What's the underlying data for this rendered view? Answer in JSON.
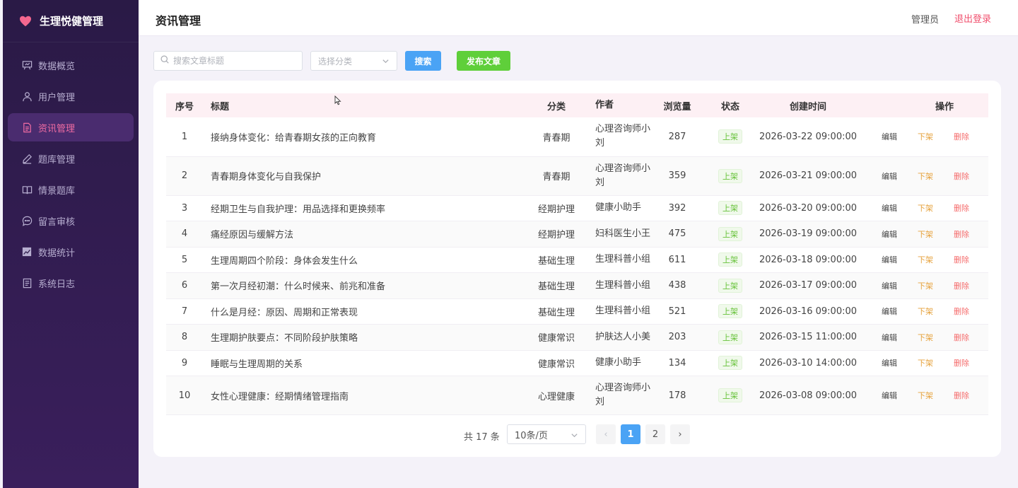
{
  "brand": {
    "title": "生理悦健管理"
  },
  "sidebar": {
    "items": [
      {
        "label": "数据概览",
        "icon": "presentation-icon",
        "active": false
      },
      {
        "label": "用户管理",
        "icon": "user-icon",
        "active": false
      },
      {
        "label": "资讯管理",
        "icon": "document-icon",
        "active": true
      },
      {
        "label": "题库管理",
        "icon": "pencil-icon",
        "active": false
      },
      {
        "label": "情景题库",
        "icon": "book-icon",
        "active": false
      },
      {
        "label": "留言审核",
        "icon": "chat-icon",
        "active": false
      },
      {
        "label": "数据统计",
        "icon": "chart-icon",
        "active": false
      },
      {
        "label": "系统日志",
        "icon": "log-icon",
        "active": false
      }
    ]
  },
  "header": {
    "title": "资讯管理",
    "admin": "管理员",
    "logout": "退出登录"
  },
  "toolbar": {
    "search_placeholder": "搜索文章标题",
    "category_placeholder": "选择分类",
    "search_label": "搜索",
    "publish_label": "发布文章"
  },
  "table": {
    "columns": [
      "序号",
      "标题",
      "分类",
      "作者",
      "浏览量",
      "状态",
      "创建时间",
      "操作"
    ],
    "rows": [
      {
        "idx": "1",
        "title": "接纳身体变化：给青春期女孩的正向教育",
        "category": "青春期",
        "author": "心理咨询师小刘",
        "views": "287",
        "status": "上架",
        "time": "2026-03-22 09:00:00"
      },
      {
        "idx": "2",
        "title": "青春期身体变化与自我保护",
        "category": "青春期",
        "author": "心理咨询师小刘",
        "views": "359",
        "status": "上架",
        "time": "2026-03-21 09:00:00"
      },
      {
        "idx": "3",
        "title": "经期卫生与自我护理：用品选择和更换频率",
        "category": "经期护理",
        "author": "健康小助手",
        "views": "392",
        "status": "上架",
        "time": "2026-03-20 09:00:00"
      },
      {
        "idx": "4",
        "title": "痛经原因与缓解方法",
        "category": "经期护理",
        "author": "妇科医生小王",
        "views": "475",
        "status": "上架",
        "time": "2026-03-19 09:00:00"
      },
      {
        "idx": "5",
        "title": "生理周期四个阶段：身体会发生什么",
        "category": "基础生理",
        "author": "生理科普小组",
        "views": "611",
        "status": "上架",
        "time": "2026-03-18 09:00:00"
      },
      {
        "idx": "6",
        "title": "第一次月经初潮：什么时候来、前兆和准备",
        "category": "基础生理",
        "author": "生理科普小组",
        "views": "438",
        "status": "上架",
        "time": "2026-03-17 09:00:00"
      },
      {
        "idx": "7",
        "title": "什么是月经：原因、周期和正常表现",
        "category": "基础生理",
        "author": "生理科普小组",
        "views": "521",
        "status": "上架",
        "time": "2026-03-16 09:00:00"
      },
      {
        "idx": "8",
        "title": "生理期护肤要点：不同阶段护肤策略",
        "category": "健康常识",
        "author": "护肤达人小美",
        "views": "203",
        "status": "上架",
        "time": "2026-03-15 11:00:00"
      },
      {
        "idx": "9",
        "title": "睡眠与生理周期的关系",
        "category": "健康常识",
        "author": "健康小助手",
        "views": "134",
        "status": "上架",
        "time": "2026-03-10 14:00:00"
      },
      {
        "idx": "10",
        "title": "女性心理健康：经期情绪管理指南",
        "category": "心理健康",
        "author": "心理咨询师小刘",
        "views": "178",
        "status": "上架",
        "time": "2026-03-08 09:00:00"
      }
    ],
    "actions": {
      "edit": "编辑",
      "off_shelf": "下架",
      "delete": "删除"
    }
  },
  "pagination": {
    "total": "共 17 条",
    "page_size": "10条/页",
    "pages": [
      "1",
      "2"
    ],
    "current": "1"
  },
  "colors": {
    "accent": "#f06ca2",
    "primary": "#4aa3f5",
    "success": "#5fcf3a",
    "sidebar_bg": "#2a1a46"
  }
}
